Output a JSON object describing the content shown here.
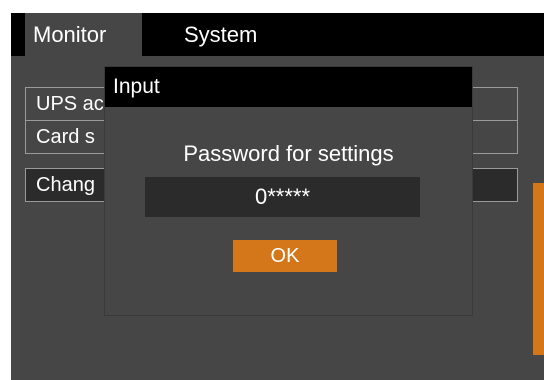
{
  "tabs": [
    {
      "label": "Monitor",
      "selected": true
    },
    {
      "label": "System",
      "selected": false
    }
  ],
  "menu": {
    "items": [
      {
        "label": "UPS ac"
      },
      {
        "label": "Card s"
      },
      {
        "label": "Chang",
        "selected": true
      }
    ]
  },
  "dialog": {
    "title": "Input",
    "prompt": "Password for settings",
    "password_value": "0*****",
    "ok_label": "OK"
  },
  "colors": {
    "background": "#464646",
    "bar": "#000000",
    "accent": "#d4761a",
    "field": "#2b2b2b"
  }
}
